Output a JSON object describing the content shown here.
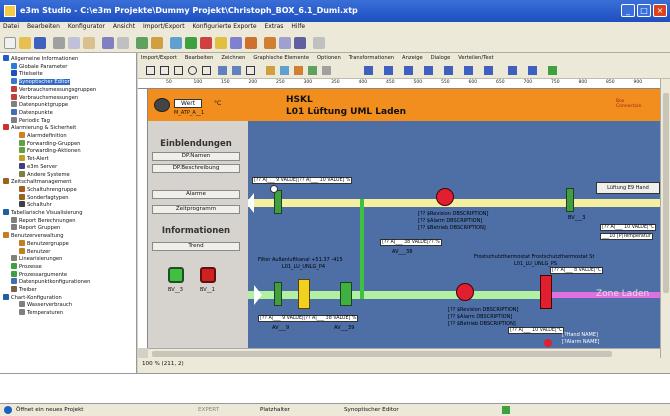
{
  "window": {
    "title": "e3m Studio - C:\\e3m Projekte\\Dummy Projekt\\Christoph_BOX_6.1_Dumi.xtp",
    "minimize": "_",
    "maximize": "□",
    "close": "×"
  },
  "menu": [
    "Datei",
    "Bearbeiten",
    "Konfigurator",
    "Ansicht",
    "Import/Export",
    "Konfigurierte Exporte",
    "Extras",
    "Hilfe"
  ],
  "tree": [
    {
      "label": "Allgemeine Informationen",
      "icon": "info-icon",
      "indent": 0,
      "color": "#2060c0"
    },
    {
      "label": "Globale Parameter",
      "icon": "globe-icon",
      "indent": 1,
      "color": "#2b7bd8"
    },
    {
      "label": "Titelseite",
      "icon": "info-icon",
      "indent": 1,
      "color": "#1d4fbf"
    },
    {
      "label": "Synoptischer Editor",
      "icon": "editor-icon",
      "indent": 1,
      "color": "#3b78c8",
      "selected": true
    },
    {
      "label": "Verbrauchsmessungsgruppen",
      "icon": "group-icon",
      "indent": 1,
      "color": "#c04040"
    },
    {
      "label": "Verbrauchsmessungen",
      "icon": "meter-icon",
      "indent": 1,
      "color": "#c04040"
    },
    {
      "label": "Datenpunktgruppe",
      "icon": "group-icon",
      "indent": 1,
      "color": "#808080"
    },
    {
      "label": "Datenpunkte",
      "icon": "datapoint-icon",
      "indent": 1,
      "color": "#4070b0"
    },
    {
      "label": "Periodic Tag",
      "icon": "tag-icon",
      "indent": 1,
      "color": "#808080"
    },
    {
      "label": "Alarmierung & Sicherheit",
      "icon": "warning-icon",
      "indent": 0,
      "color": "#d03030"
    },
    {
      "label": "Alarmdefinition",
      "icon": "alarm-icon",
      "indent": 2,
      "color": "#d08020"
    },
    {
      "label": "Forwarding-Gruppen",
      "icon": "forward-icon",
      "indent": 2,
      "color": "#60a040"
    },
    {
      "label": "Forwarding-Aktionen",
      "icon": "forward-icon",
      "indent": 2,
      "color": "#60a040"
    },
    {
      "label": "Tet-Alert",
      "icon": "alert-icon",
      "indent": 2,
      "color": "#c0a020"
    },
    {
      "label": "e3m Server",
      "icon": "server-icon",
      "indent": 2,
      "color": "#404080"
    },
    {
      "label": "Andere Systeme",
      "icon": "system-icon",
      "indent": 2,
      "color": "#808040"
    },
    {
      "label": "Zeitschaltmanagement",
      "icon": "clock-icon",
      "indent": 0,
      "color": "#a06020"
    },
    {
      "label": "Schaltuhrengruppe",
      "icon": "group-icon",
      "indent": 2,
      "color": "#a06020"
    },
    {
      "label": "Sonderfagtypen",
      "icon": "calendar-icon",
      "indent": 2,
      "color": "#a06020"
    },
    {
      "label": "Schaltuhr",
      "icon": "clock-icon",
      "indent": 2,
      "color": "#404040"
    },
    {
      "label": "Tabellarische Visualisierung",
      "icon": "table-icon",
      "indent": 0,
      "color": "#2060a0"
    },
    {
      "label": "Report Berechnungen",
      "icon": "report-icon",
      "indent": 1,
      "color": "#808080"
    },
    {
      "label": "Report Gruppen",
      "icon": "report-icon",
      "indent": 1,
      "color": "#808080"
    },
    {
      "label": "Benutzerverwaltung",
      "icon": "users-icon",
      "indent": 0,
      "color": "#c08020"
    },
    {
      "label": "Benutzergruppe",
      "icon": "group-icon",
      "indent": 2,
      "color": "#c08020"
    },
    {
      "label": "Benutzer",
      "icon": "user-icon",
      "indent": 2,
      "color": "#c08020"
    },
    {
      "label": "Linearisierungen",
      "icon": "curve-icon",
      "indent": 1,
      "color": "#808080"
    },
    {
      "label": "Prozesse",
      "icon": "process-icon",
      "indent": 1,
      "color": "#40a040"
    },
    {
      "label": "Prozessargumente",
      "icon": "process-icon",
      "indent": 1,
      "color": "#40a040"
    },
    {
      "label": "Datenpunktkonfigurationen",
      "icon": "config-icon",
      "indent": 1,
      "color": "#4070b0"
    },
    {
      "label": "Treiber",
      "icon": "driver-icon",
      "indent": 1,
      "color": "#806040"
    },
    {
      "label": "Chart-Konfiguration",
      "icon": "chart-icon",
      "indent": 0,
      "color": "#2060a0"
    },
    {
      "label": "Wasserverbrauch",
      "icon": "chart-icon",
      "indent": 2,
      "color": "#808080"
    },
    {
      "label": "Temperaturen",
      "icon": "chart-icon",
      "indent": 2,
      "color": "#808080"
    }
  ],
  "editor_tabs": [
    "Import/Export",
    "Bearbeiten",
    "Zeichnen",
    "Graphische Elemente",
    "Optionen",
    "Transformationen",
    "Anzeige",
    "Dialoge",
    "Verteilen/Text"
  ],
  "ruler": [
    "50",
    "100",
    "150",
    "200",
    "250",
    "300",
    "350",
    "400",
    "450",
    "500",
    "550",
    "600",
    "650",
    "700",
    "750",
    "800",
    "850",
    "900",
    "950"
  ],
  "diagram": {
    "header_title": "HSKL",
    "header_subtitle": "L01 Lüftung UML Laden",
    "wert_label": "Wert",
    "wert_unit": "°C",
    "wert_ref": "M_ATP_A__1",
    "brand": "Box Connection",
    "sections": {
      "einblendungen": "Einblendungen",
      "informationen": "Informationen"
    },
    "buttons": {
      "dp_namen": "DP.Namen",
      "dp_beschreibung": "DP.Beschreibung",
      "alarme": "Alarme",
      "zeitprogramm": "Zeitprogramm",
      "trend": "Trend"
    },
    "status_labels": {
      "on": "BV__3",
      "off": "BV__1"
    },
    "values": {
      "v1": "[?? A|___ 9 VALUE|[?? A|___ 10 VALUE] %",
      "v2": "[?? A|___ 38 VALUE|?? %",
      "v3": "AV___38",
      "v4": "[?? A|___ 10 VALUE|°C",
      "v5": "___10 [P|Temperatur",
      "v6": "[?? A|___ 9 VALUE|[?? A|___ 38 VALUE] %",
      "v7": "AV___9",
      "v8": "AV___39",
      "v9": "[?? A|___ 8 VALUE|°C",
      "v10": "[?? A|___ 10 VALUE|°C"
    },
    "info_lines": {
      "fan1": [
        "[?? $Revision DBSCRIPTION]",
        "[?? $Alarm DBSCRIPTION]",
        "[?? $Betrieb DBSCRIPTION]"
      ],
      "fan2": [
        "[?? $Revision DBSCRIPTION]",
        "[?? $Alarm DBSCRIPTION]",
        "[?? $Betrieb DBSCRIPTION]"
      ]
    },
    "filter_label": "Filter Außenluftkanal +51.37 -415",
    "filter_sub": "L01_LU_UNLG_P4",
    "frost_label": "Frostschutzthermostat Frostschutzthermostat St",
    "frost_sub": "L01_LU_UNLG_PS",
    "zone_label": "Zone Laden",
    "lueftung_btn": "Lüftung E9 Hand",
    "bv_label": "BV___3",
    "alarm_lines": [
      "[?Hand NAME]",
      "[?Alarm NAME]"
    ]
  },
  "zoom": "100 % (211, 2)",
  "status": {
    "left": "Öffnet ein neues Projekt",
    "item2": "EXPERT",
    "item3": "Platzhalter",
    "item4": "Synoptischer Editor"
  }
}
